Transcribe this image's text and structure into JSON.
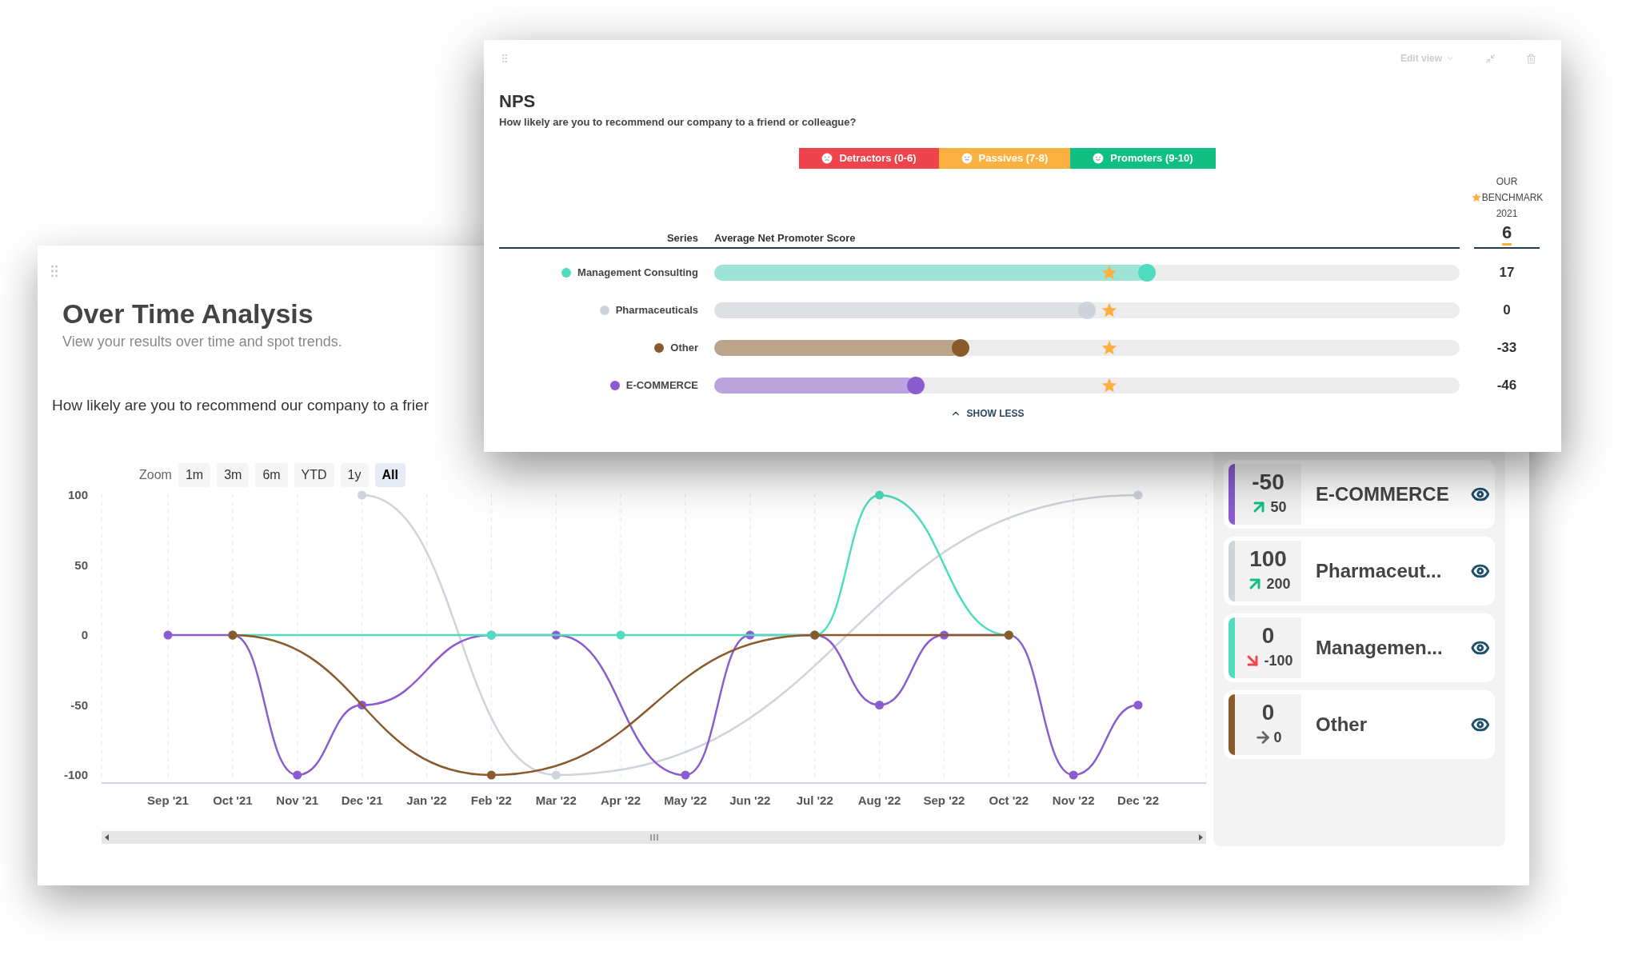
{
  "over_time": {
    "title": "Over Time Analysis",
    "subtitle": "View your results over time and spot trends.",
    "question": "How likely are you to recommend our company to a frier",
    "zoom": {
      "label": "Zoom",
      "options": [
        {
          "label": "1m",
          "selected": false
        },
        {
          "label": "3m",
          "selected": false
        },
        {
          "label": "6m",
          "selected": false
        },
        {
          "label": "YTD",
          "selected": false
        },
        {
          "label": "1y",
          "selected": false
        },
        {
          "label": "All",
          "selected": true
        }
      ]
    },
    "chart_data": {
      "type": "line",
      "grid": true,
      "categories": [
        "Sep '21",
        "Oct '21",
        "Nov '21",
        "Dec '21",
        "Jan '22",
        "Feb '22",
        "Mar '22",
        "Apr '22",
        "May '22",
        "Jun '22",
        "Jul '22",
        "Aug '22",
        "Sep '22",
        "Oct '22",
        "Nov '22",
        "Dec '22"
      ],
      "ylim": [
        -100,
        100
      ],
      "yticks": [
        100,
        50,
        0,
        -50,
        -100
      ],
      "series": [
        {
          "color": "#8a5cd0",
          "marker": true,
          "values": [
            0,
            0,
            -100,
            -50,
            null,
            0,
            0,
            null,
            -100,
            0,
            0,
            -50,
            0,
            0,
            -100,
            -50
          ]
        },
        {
          "color": "#cfd3db",
          "marker": true,
          "values": [
            null,
            null,
            null,
            100,
            null,
            null,
            -100,
            null,
            null,
            null,
            null,
            null,
            null,
            null,
            null,
            100
          ]
        },
        {
          "color": "#4fdcbf",
          "marker": true,
          "values": [
            null,
            0,
            null,
            null,
            null,
            0,
            null,
            0,
            null,
            null,
            0,
            100,
            null,
            0,
            null,
            null
          ]
        },
        {
          "color": "#8b5a2b",
          "marker": true,
          "values": [
            null,
            0,
            null,
            null,
            null,
            -100,
            null,
            null,
            null,
            null,
            0,
            null,
            null,
            0,
            null,
            null
          ]
        }
      ]
    },
    "series_cards": [
      {
        "name": "E-COMMERCE",
        "color": "#8a5cd0",
        "value": "-50",
        "kind": "up",
        "change": "50"
      },
      {
        "name": "Pharmaceut...",
        "color": "#cfd3db",
        "value": "100",
        "kind": "up",
        "change": "200"
      },
      {
        "name": "Managemen...",
        "color": "#4fdcbf",
        "value": "0",
        "kind": "down",
        "change": "-100"
      },
      {
        "name": "Other",
        "color": "#8b5a2b",
        "value": "0",
        "kind": "flat",
        "change": "0"
      }
    ]
  },
  "nps": {
    "edit_view": "Edit view",
    "title": "NPS",
    "question": "How likely are you to recommend our company to a friend or colleague?",
    "legend": [
      {
        "kind": "detractor",
        "label": "Detractors (0-6)",
        "color": "#f0444c"
      },
      {
        "kind": "passive",
        "label": "Passives (7-8)",
        "color": "#fbb040"
      },
      {
        "kind": "promoter",
        "label": "Promoters (9-10)",
        "color": "#10c083"
      }
    ],
    "benchmark": {
      "lines": [
        "OUR",
        "BENCHMARK",
        "2021"
      ],
      "value": "6"
    },
    "columns": {
      "series": "Series",
      "score": "Average Net Promoter Score"
    },
    "rows": [
      {
        "name": "Management Consulting",
        "color": "#4fdcbf",
        "level": 0.58,
        "value": "17"
      },
      {
        "name": "Pharmaceuticals",
        "color": "#cfd3db",
        "level": 0.5,
        "value": "0"
      },
      {
        "name": "Other",
        "color": "#8b5a2b",
        "level": 0.33,
        "value": "-33"
      },
      {
        "name": "E-COMMERCE",
        "color": "#8a5cd0",
        "level": 0.27,
        "value": "-46"
      }
    ],
    "toggle": "SHOW LESS"
  }
}
